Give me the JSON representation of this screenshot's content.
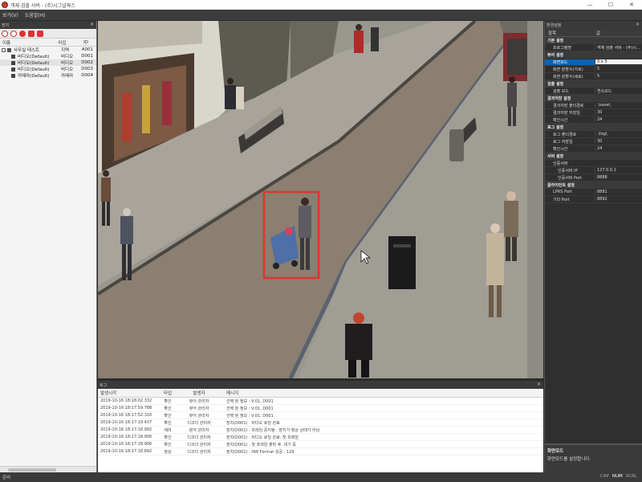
{
  "window": {
    "title": "객체 검출 서버 - (주)시그널웍스",
    "minimize": "—",
    "maximize": "☐",
    "close": "✕"
  },
  "menu": [
    "보기(V)",
    "도움말(H)"
  ],
  "left_panel": {
    "header": "장치",
    "columns": {
      "name": "이름",
      "type": "타입",
      "id": "ID"
    },
    "rows": [
      {
        "name": "사무실 테스트",
        "type": "지역",
        "id": "A001"
      },
      {
        "name": "비디오(Default)",
        "type": "비디오",
        "id": "D001"
      },
      {
        "name": "비디오(Default)",
        "type": "비디오",
        "id": "D002"
      },
      {
        "name": "비디오(Default)",
        "type": "비디오",
        "id": "D003"
      },
      {
        "name": "카메라(Default)",
        "type": "카메라",
        "id": "D004"
      }
    ]
  },
  "log_panel": {
    "header": "로그",
    "columns": {
      "time": "발생시각",
      "type": "타입",
      "source": "발생자",
      "message": "메시지"
    },
    "rows": [
      {
        "time": "2019-10-16 18:18:02.332",
        "type": "확인",
        "source": "뷰어 관리자",
        "message": "선택 된 정보 : V:01, D001"
      },
      {
        "time": "2019-10-16 18:17:59.788",
        "type": "확인",
        "source": "뷰어 관리자",
        "message": "선택 된 정보 : V:01, D001"
      },
      {
        "time": "2019-10-16 18:17:52.316",
        "type": "확인",
        "source": "뷰어 관리자",
        "message": "선택 된 정보 : V:01, D001"
      },
      {
        "time": "2019-10-16 18:17:19.437",
        "type": "확인",
        "source": "디코더 관리자",
        "message": "장치(D001) : 비디오 로딩 완료"
      },
      {
        "time": "2019-10-16 18:17:18.992",
        "type": "에러",
        "source": "분석 관리자",
        "message": "장치(D001) : 프레임 중지됨 : 장치가 정상 상태가 아님"
      },
      {
        "time": "2019-10-16 18:17:18.906",
        "type": "확인",
        "source": "디코더 관리자",
        "message": "장치(D001) : 비디오 로딩 완료, 첫 프레임"
      },
      {
        "time": "2019-10-16 18:17:18.906",
        "type": "확인",
        "source": "디코더 관리자",
        "message": "장치(D001) : 첫 프레임 출력 후, 대기 중"
      },
      {
        "time": "2019-10-16 18:17:18.892",
        "type": "정상",
        "source": "디코더 관리자",
        "message": "장치(D001) : HW Format 성공 : 129"
      }
    ]
  },
  "right_panel": {
    "header": "환경설정",
    "columns": {
      "key": "항목",
      "value": "값"
    },
    "rows": [
      {
        "kind": "cat",
        "k": "기본 설정",
        "v": ""
      },
      {
        "kind": "item",
        "k": "프로그램명",
        "v": "객체 검출 서버 - (주)시..."
      },
      {
        "kind": "cat",
        "k": "뷰어 설정",
        "v": ""
      },
      {
        "kind": "selected",
        "k": "화면모드",
        "v": "3 x 3"
      },
      {
        "kind": "item",
        "k": "화면 분할수(가로)",
        "v": "5"
      },
      {
        "kind": "item",
        "k": "화면 분할수(세로)",
        "v": "5"
      },
      {
        "kind": "cat",
        "k": "검출 설정",
        "v": ""
      },
      {
        "kind": "item",
        "k": "검출 모드",
        "v": "연속모드"
      },
      {
        "kind": "cat",
        "k": "결과저장 설정",
        "v": ""
      },
      {
        "kind": "item",
        "k": "결과저장 폴더경로",
        "v": ".\\save\\"
      },
      {
        "kind": "item",
        "k": "결과저장 저장일",
        "v": "30"
      },
      {
        "kind": "item",
        "k": "확인시간",
        "v": "24"
      },
      {
        "kind": "cat",
        "k": "로그 설정",
        "v": ""
      },
      {
        "kind": "item",
        "k": "로그 폴더경로",
        "v": ".\\log\\"
      },
      {
        "kind": "item",
        "k": "로그 저장일",
        "v": "30"
      },
      {
        "kind": "item",
        "k": "확인시간",
        "v": "24"
      },
      {
        "kind": "cat",
        "k": "서버 설정",
        "v": ""
      },
      {
        "kind": "sub",
        "k": "인증서버",
        "v": ""
      },
      {
        "kind": "sub2",
        "k": "인증서버 IP",
        "v": "127.0.0.1"
      },
      {
        "kind": "sub2",
        "k": "인증서버 Port",
        "v": "8888"
      },
      {
        "kind": "cat",
        "k": "클라이언트 설정",
        "v": ""
      },
      {
        "kind": "item",
        "k": "LPRS Port",
        "v": "8891"
      },
      {
        "kind": "item",
        "k": "기타 Port",
        "v": "8892"
      }
    ],
    "description": {
      "title": "화면모드",
      "text": "화면모드를 설정합니다."
    }
  },
  "status": {
    "left": "준비",
    "caps": "CAP",
    "num": "NUM",
    "scrl": "SCRL"
  },
  "colors": {
    "detection_box": "#d9382a",
    "selection": "#0a64b8"
  }
}
